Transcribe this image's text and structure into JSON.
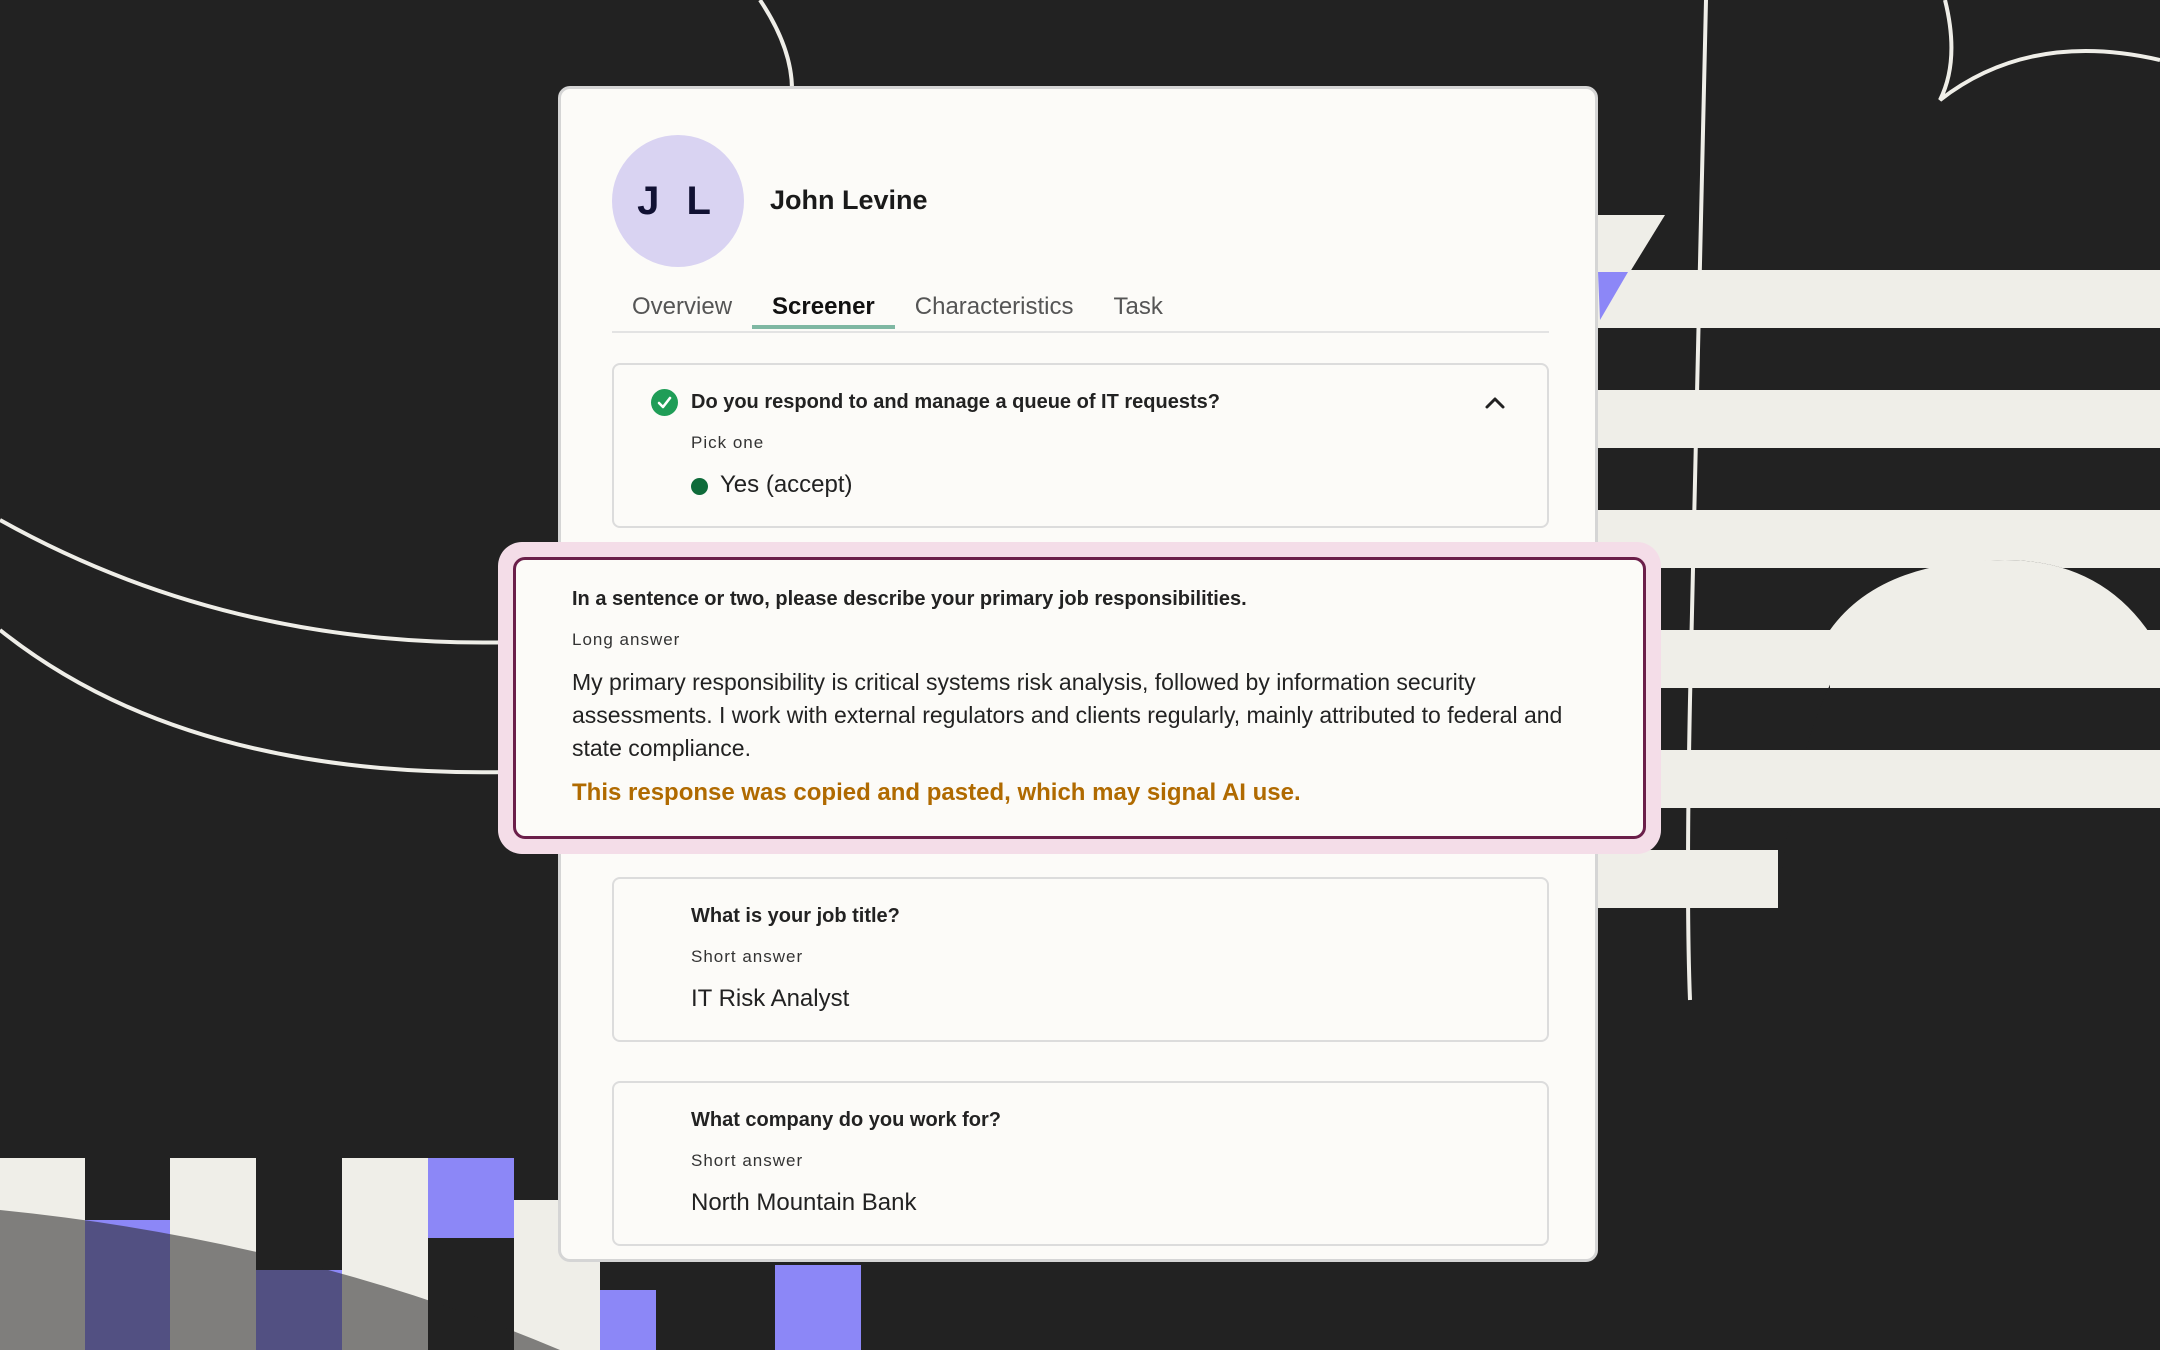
{
  "profile": {
    "initials": "J L",
    "name": "John Levine"
  },
  "tabs": [
    {
      "label": "Overview",
      "active": false
    },
    {
      "label": "Screener",
      "active": true
    },
    {
      "label": "Characteristics",
      "active": false
    },
    {
      "label": "Task",
      "active": false
    }
  ],
  "questions": [
    {
      "title": "Do you respond to and manage a queue of IT requests?",
      "type": "Pick one",
      "answer": "Yes (accept)",
      "status_icon": "check-circle-icon",
      "expanded": true
    },
    {
      "title": "In a sentence or two, please describe your primary job responsibilities.",
      "type": "Long answer",
      "answer": "My primary responsibility is critical systems risk analysis, followed by information security assessments. I work with external regulators and clients regularly, mainly attributed to federal and state compliance.",
      "warning": "This response was copied and pasted, which may signal AI use."
    },
    {
      "title": "What is your job title?",
      "type": "Short answer",
      "answer": "IT Risk Analyst"
    },
    {
      "title": "What company do you work for?",
      "type": "Short answer",
      "answer": "North Mountain Bank"
    }
  ],
  "colors": {
    "background": "#222222",
    "avatar": "#d9d3f2",
    "active_tab_underline": "#7fb8a3",
    "check": "#1f9d57",
    "highlight_border": "#6b1f4a",
    "warning_text": "#b06a00",
    "decor_purple": "#8c87f7",
    "decor_cream": "#efeee8"
  }
}
